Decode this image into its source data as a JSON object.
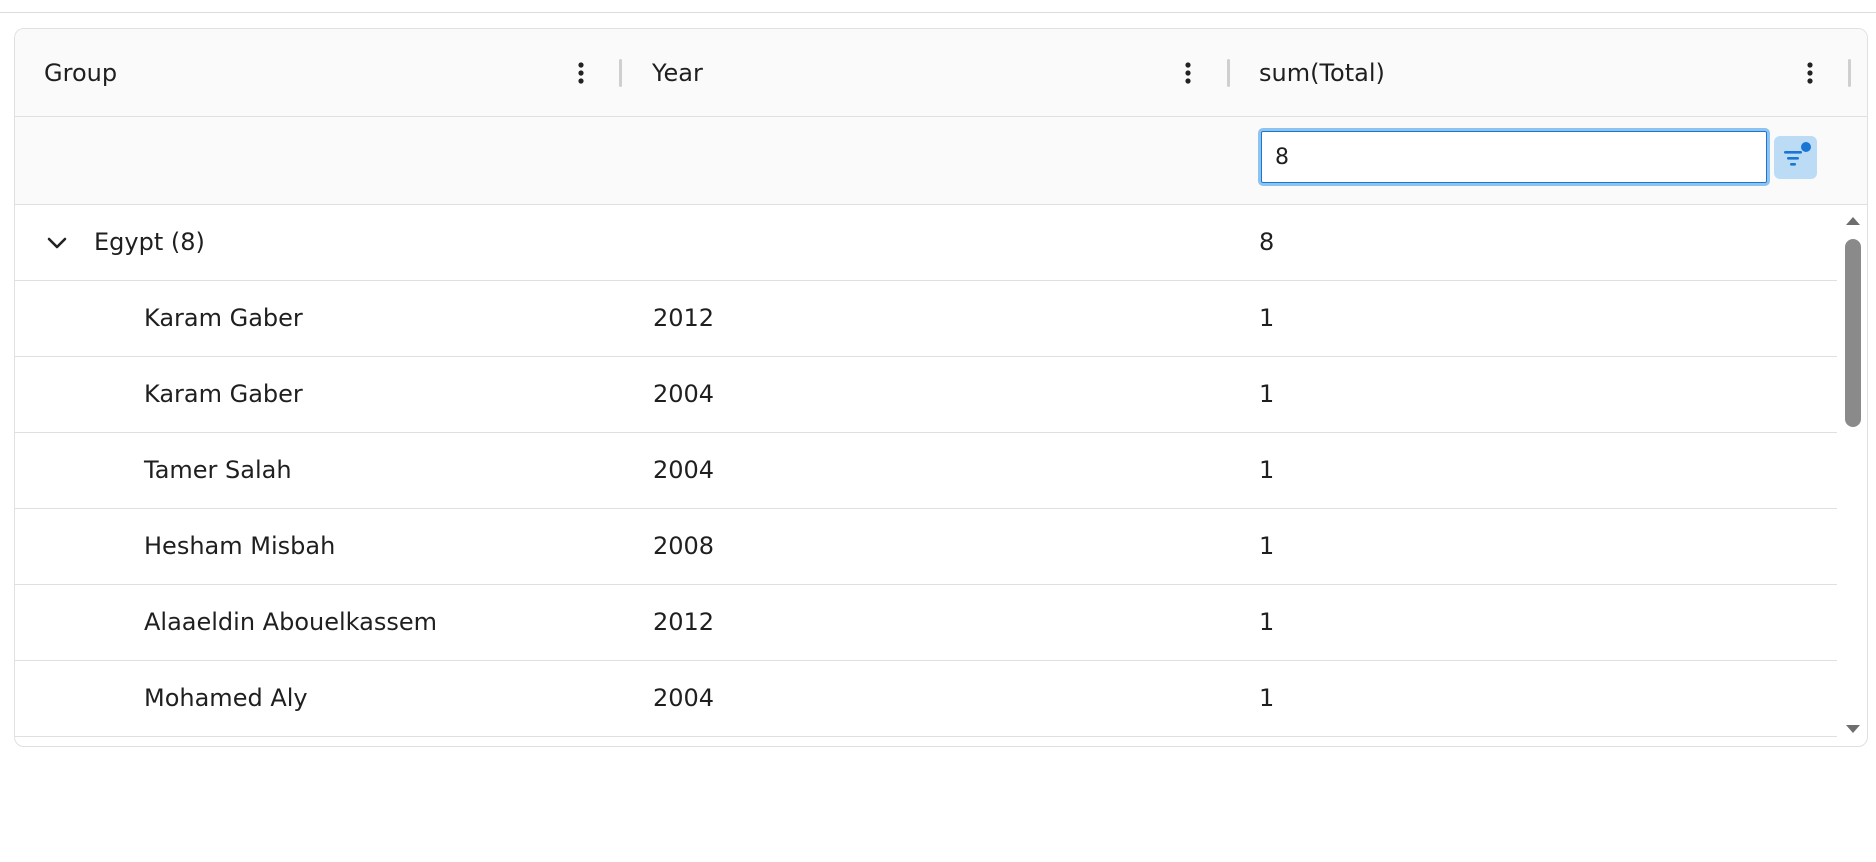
{
  "columns": [
    {
      "label": "Group"
    },
    {
      "label": "Year"
    },
    {
      "label": "sum(Total)"
    }
  ],
  "filter": {
    "value": "8"
  },
  "group": {
    "label": "Egypt (8)",
    "total": "8",
    "expanded": true
  },
  "rows": [
    {
      "group": "Karam Gaber",
      "year": "2012",
      "total": "1"
    },
    {
      "group": "Karam Gaber",
      "year": "2004",
      "total": "1"
    },
    {
      "group": "Tamer Salah",
      "year": "2004",
      "total": "1"
    },
    {
      "group": "Hesham Misbah",
      "year": "2008",
      "total": "1"
    },
    {
      "group": "Alaaeldin Abouelkassem",
      "year": "2012",
      "total": "1"
    },
    {
      "group": "Mohamed Aly",
      "year": "2004",
      "total": "1"
    }
  ],
  "icons": {
    "column_menu": "more-vert-icon",
    "filter": "filter-list-icon",
    "expand": "chevron-down-icon"
  },
  "colors": {
    "accent": "#1976d2",
    "filter_bg": "#bcdcf6",
    "input_border": "#8fc3ef"
  }
}
